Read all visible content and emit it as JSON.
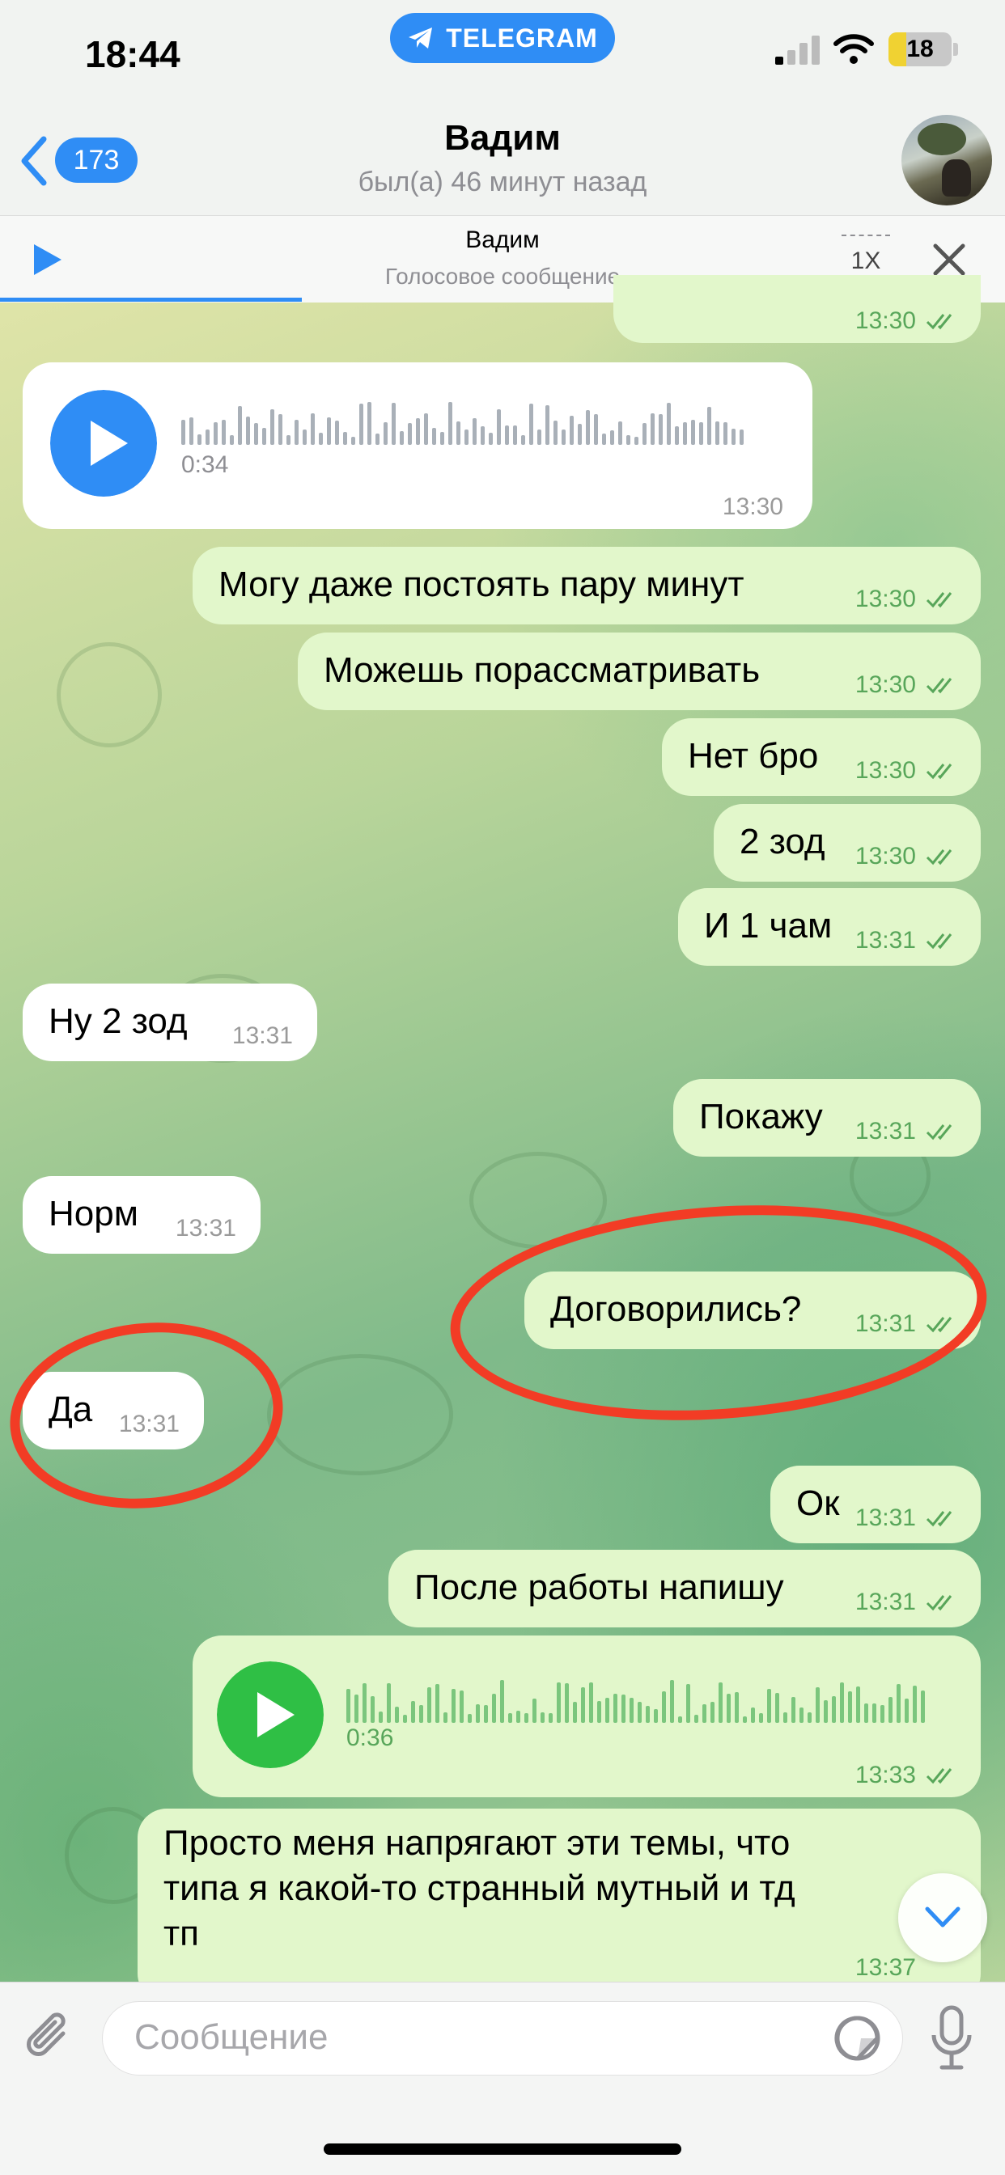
{
  "status_bar": {
    "time": "18:44",
    "app_pill": "TELEGRAM",
    "battery": "18"
  },
  "header": {
    "back_count": "173",
    "title": "Вадим",
    "subtitle": "был(а) 46 минут назад"
  },
  "player": {
    "name": "Вадим",
    "subtitle": "Голосовое сообщение",
    "speed": "1X",
    "progress": 0.3
  },
  "messages": [
    {
      "dir": "out",
      "type": "partial",
      "time": "13:30"
    },
    {
      "dir": "in",
      "type": "voice",
      "duration": "0:34",
      "time": "13:30"
    },
    {
      "dir": "out",
      "text": "Могу даже постоять пару минут",
      "time": "13:30"
    },
    {
      "dir": "out",
      "text": "Можешь порассматривать",
      "time": "13:30"
    },
    {
      "dir": "out",
      "text": "Нет бро",
      "time": "13:30"
    },
    {
      "dir": "out",
      "text": "2 зод",
      "time": "13:30"
    },
    {
      "dir": "out",
      "text": "И 1 чам",
      "time": "13:31"
    },
    {
      "dir": "in",
      "text": "Ну 2 зод",
      "time": "13:31"
    },
    {
      "dir": "out",
      "text": "Покажу",
      "time": "13:31"
    },
    {
      "dir": "in",
      "text": "Норм",
      "time": "13:31"
    },
    {
      "dir": "out",
      "text": "Договорились?",
      "time": "13:31"
    },
    {
      "dir": "in",
      "text": "Да",
      "time": "13:31"
    },
    {
      "dir": "out",
      "text": "Ок",
      "time": "13:31"
    },
    {
      "dir": "out",
      "text": "После работы напишу",
      "time": "13:31"
    },
    {
      "dir": "out",
      "type": "voice",
      "duration": "0:36",
      "time": "13:33"
    },
    {
      "dir": "out",
      "line1": "Просто меня напрягают эти темы, что",
      "line2": "типа я какой-то странный мутный и тд",
      "line3": "тп",
      "time": "13:37"
    }
  ],
  "input": {
    "placeholder": "Сообщение"
  },
  "icons": {
    "back": "chevron-left-icon",
    "play": "play-icon",
    "close": "close-icon",
    "attach": "paperclip-icon",
    "sticker": "sticker-icon",
    "mic": "microphone-icon",
    "scroll": "chevron-down-icon",
    "ticks": "double-check-icon"
  },
  "colors": {
    "accent": "#2f8df5",
    "outgoing_bubble": "#e2f7cb",
    "incoming_bubble": "#ffffff",
    "outgoing_time": "#58a65a",
    "voice_play_out": "#2fbf45",
    "annotation": "#f23c25"
  }
}
